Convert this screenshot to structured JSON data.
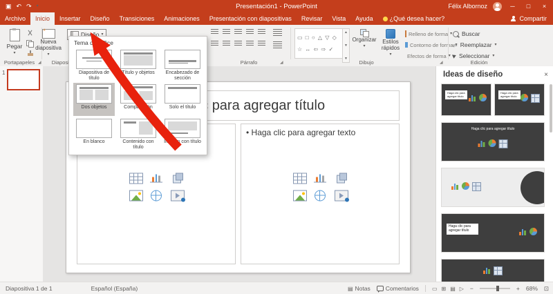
{
  "colors": {
    "ribbon_red": "#C43E1C",
    "selection_red": "#C4391D",
    "arrow_red": "#E8220D"
  },
  "icons": {
    "save": "▣",
    "undo": "↶",
    "redo": "↷",
    "qat_more": "▾",
    "minimize": "─",
    "maximize": "□",
    "close": "×",
    "dropdown": "▾",
    "launcher": "◢",
    "replace_arrows": "⇄",
    "shapes_row1": "▭ □ ○ △ ▽ ◇",
    "shapes_row2": "☆ ↔ ⇦ ⇨ ✓",
    "scroll_up": "▲",
    "scroll_down": "▼",
    "scroll_more": "▼",
    "notes": "▤",
    "view_normal": "▭",
    "view_sorter": "⊞",
    "view_reading": "▤",
    "view_slideshow": "▷",
    "zoom_out": "−",
    "zoom_in": "+",
    "fit": "⊡"
  },
  "title_bar": {
    "title": "Presentación1 - PowerPoint",
    "user": "Félix Albornoz"
  },
  "tabs": [
    {
      "label": "Archivo"
    },
    {
      "label": "Inicio",
      "active": true
    },
    {
      "label": "Insertar"
    },
    {
      "label": "Diseño"
    },
    {
      "label": "Transiciones"
    },
    {
      "label": "Animaciones"
    },
    {
      "label": "Presentación con diapositivas"
    },
    {
      "label": "Revisar"
    },
    {
      "label": "Vista"
    },
    {
      "label": "Ayuda"
    },
    {
      "label": "¿Qué desea hacer?"
    }
  ],
  "share_label": "Compartir",
  "ribbon": {
    "paste": "Pegar",
    "clipboard_group": "Portapapeles",
    "new_slide": "Nueva diapositiva",
    "layout_button": "Diseño",
    "slides_group": "Diapositivas",
    "paragraph_group": "Párrafo",
    "drawing_group": "Dibujo",
    "editing_group": "Edición",
    "organize": "Organizar",
    "quick_styles": "Estilos rápidos",
    "shape_fill": "Relleno de forma",
    "shape_outline": "Contorno de forma",
    "shape_effects": "Efectos de forma",
    "find": "Buscar",
    "replace": "Reemplazar",
    "select": "Seleccionar"
  },
  "layout_menu": {
    "title": "Tema de Office",
    "items": [
      {
        "label": "Diapositiva de título"
      },
      {
        "label": "Título y objetos"
      },
      {
        "label": "Encabezado de sección"
      },
      {
        "label": "Dos objetos",
        "selected": true
      },
      {
        "label": "Comparación"
      },
      {
        "label": "Solo el título"
      },
      {
        "label": "En blanco"
      },
      {
        "label": "Contenido con título"
      },
      {
        "label": "Imagen con título"
      }
    ]
  },
  "slides_panel": {
    "slide_number": "1"
  },
  "slide": {
    "title_placeholder": "Haga clic para agregar título",
    "body_placeholder": "• Haga clic para agregar texto"
  },
  "design_ideas": {
    "title": "Ideas de diseño",
    "thumb_title": "Haga clic para agregar título"
  },
  "status_bar": {
    "slide_counter": "Diapositiva 1 de 1",
    "language": "Español (España)",
    "notes": "Notas",
    "comments": "Comentarios",
    "zoom": "68%"
  }
}
